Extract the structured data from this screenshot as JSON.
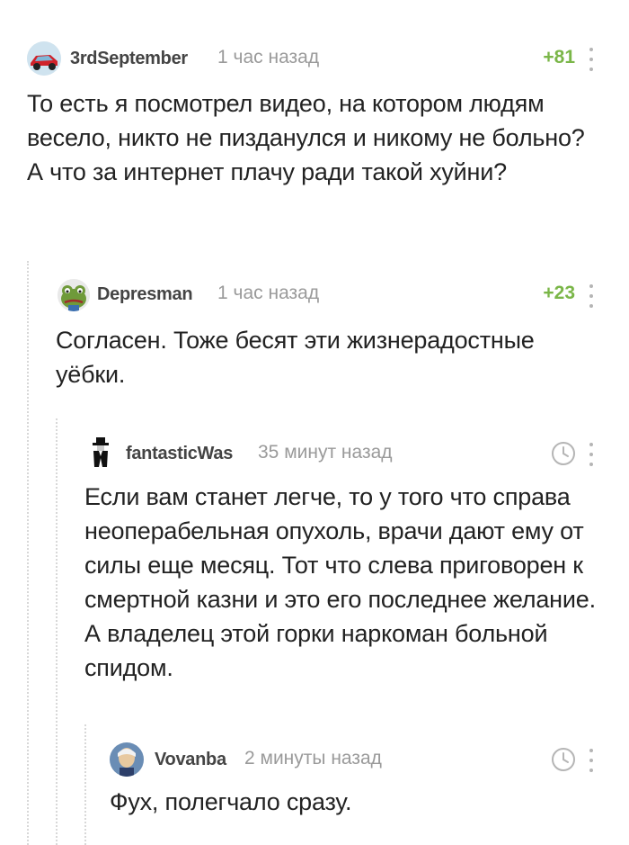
{
  "comments": [
    {
      "username": "3rdSeptember",
      "time": "1 час назад",
      "rating": "+81",
      "avatar_icon": "car-avatar-icon",
      "text": "То есть я посмотрел видео, на котором людям весело, никто не пизданулся и никому не больно? А что за интернет плачу ради такой хуйни?"
    },
    {
      "username": "Depresman",
      "time": "1 час назад",
      "rating": "+23",
      "avatar_icon": "frog-avatar-icon",
      "text": "Согласен. Тоже бесят эти жизнерадостные уёбки."
    },
    {
      "username": "fantasticWas",
      "time": "35 минут назад",
      "rating": "",
      "avatar_icon": "man-in-hat-icon",
      "text": "Если вам станет легче, то у того что справа неоперабельная опухоль, врачи дают ему от силы еще месяц. Тот что слева приговорен к смертной казни и это его последнее желание. А владелец этой горки наркоман больной спидом."
    },
    {
      "username": "Vovanba",
      "time": "2 минуты назад",
      "rating": "",
      "avatar_icon": "portrait-avatar-icon",
      "text": "Фух, полегчало сразу."
    }
  ],
  "colors": {
    "rating": "#7ab648",
    "meta": "#9a9a9a",
    "username": "#444444",
    "text": "#222222",
    "thread_line": "#d8d8d8"
  }
}
